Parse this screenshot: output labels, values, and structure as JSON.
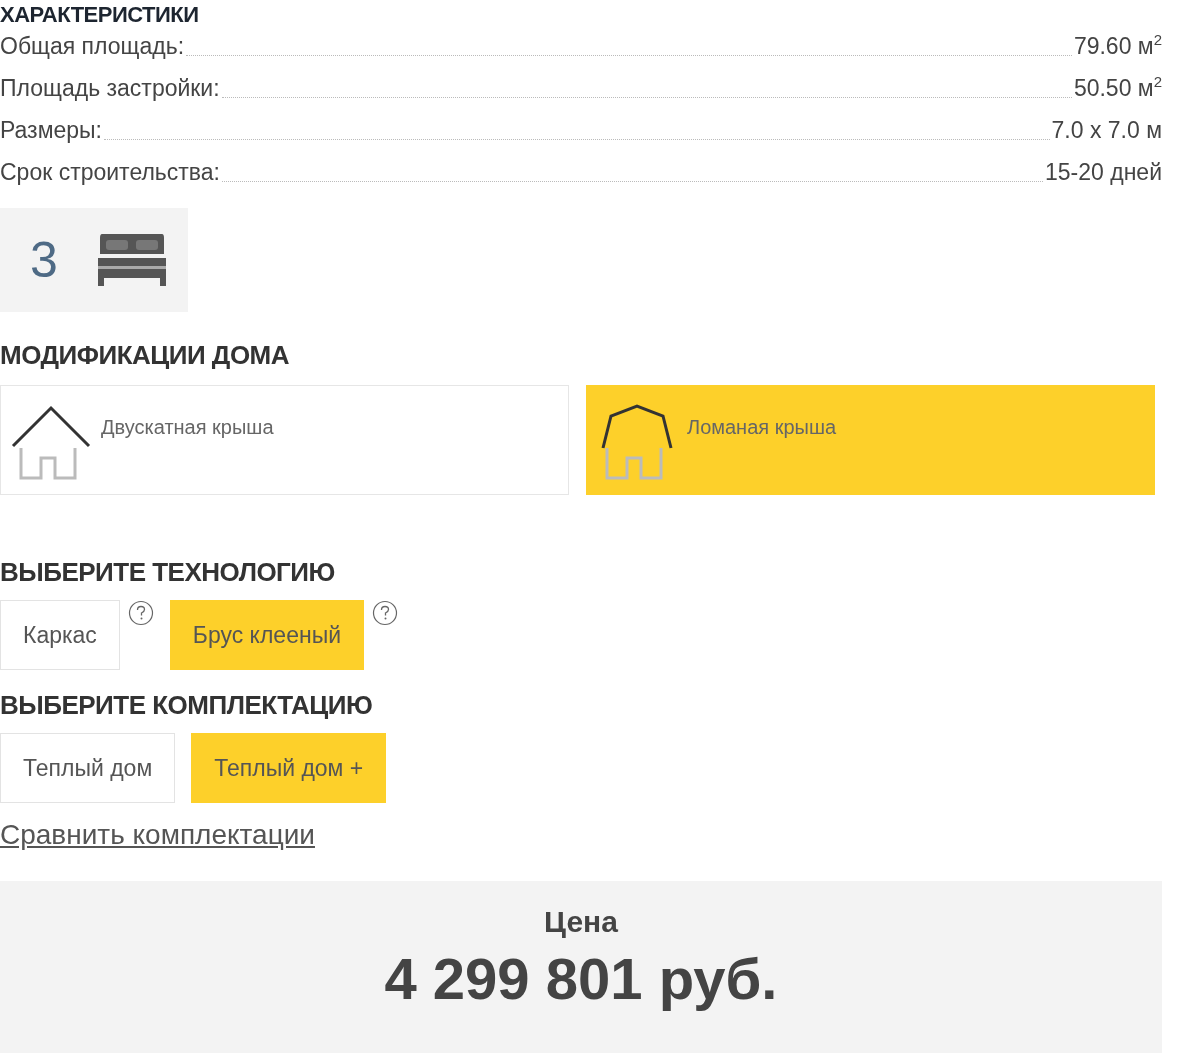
{
  "specs": {
    "title": "ХАРАКТЕРИСТИКИ",
    "rows": [
      {
        "label": "Общая площадь:",
        "value": "79.60 м$^{2}$"
      },
      {
        "label": "Площадь застройки:",
        "value": "50.50 м$^{2}$"
      },
      {
        "label": "Размеры:",
        "value": "7.0 x 7.0 м"
      },
      {
        "label": "Срок строительства:",
        "value": "15-20 дней"
      }
    ]
  },
  "bedrooms": {
    "count": "3"
  },
  "modifications": {
    "title": "МОДИФИКАЦИИ ДОМА",
    "items": [
      {
        "kind": "gable",
        "label": "Двускатная крыша",
        "selected": false
      },
      {
        "kind": "mansard",
        "label": "Ломаная крыша",
        "selected": true
      }
    ]
  },
  "technology": {
    "title": "ВЫБЕРИТЕ ТЕХНОЛОГИЮ",
    "options": [
      {
        "label": "Каркас",
        "selected": false
      },
      {
        "label": "Брус клееный",
        "selected": true
      }
    ]
  },
  "package": {
    "title": "ВЫБЕРИТЕ КОМПЛЕКТАЦИЮ",
    "options": [
      {
        "label": "Теплый дом",
        "selected": false
      },
      {
        "label": "Теплый дом +",
        "selected": true
      }
    ],
    "compare_link": "Сравнить комплектации"
  },
  "price": {
    "label": "Цена",
    "amount": "4 299 801 руб."
  }
}
